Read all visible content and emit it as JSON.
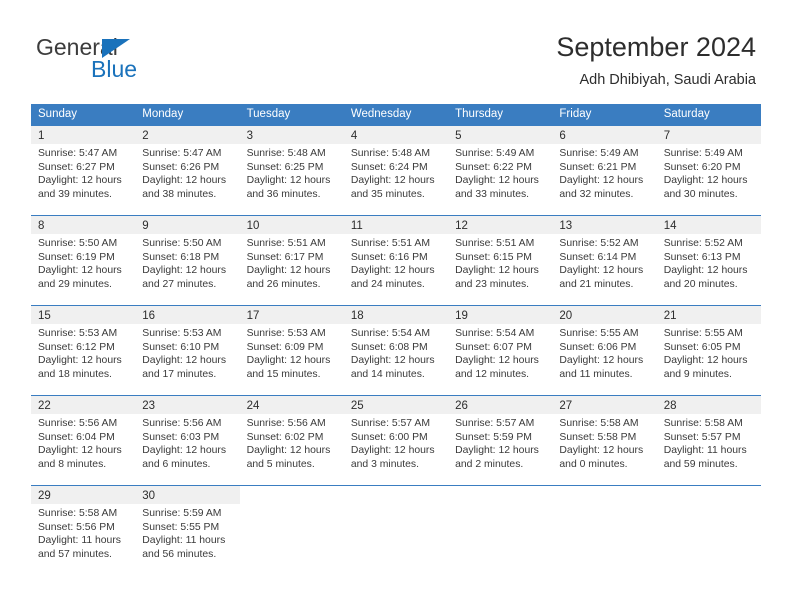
{
  "logo": {
    "word_one": "General",
    "word_two": "Blue",
    "triangle_icon": "triangle-icon",
    "accent_color": "#1a72bb"
  },
  "header": {
    "title": "September 2024",
    "subtitle": "Adh Dhibiyah, Saudi Arabia"
  },
  "calendar": {
    "header_color": "#3a7dc1",
    "weekdays": [
      "Sunday",
      "Monday",
      "Tuesday",
      "Wednesday",
      "Thursday",
      "Friday",
      "Saturday"
    ],
    "weeks": [
      [
        {
          "day": "1",
          "sunrise": "Sunrise: 5:47 AM",
          "sunset": "Sunset: 6:27 PM",
          "daylight_1": "Daylight: 12 hours",
          "daylight_2": "and 39 minutes."
        },
        {
          "day": "2",
          "sunrise": "Sunrise: 5:47 AM",
          "sunset": "Sunset: 6:26 PM",
          "daylight_1": "Daylight: 12 hours",
          "daylight_2": "and 38 minutes."
        },
        {
          "day": "3",
          "sunrise": "Sunrise: 5:48 AM",
          "sunset": "Sunset: 6:25 PM",
          "daylight_1": "Daylight: 12 hours",
          "daylight_2": "and 36 minutes."
        },
        {
          "day": "4",
          "sunrise": "Sunrise: 5:48 AM",
          "sunset": "Sunset: 6:24 PM",
          "daylight_1": "Daylight: 12 hours",
          "daylight_2": "and 35 minutes."
        },
        {
          "day": "5",
          "sunrise": "Sunrise: 5:49 AM",
          "sunset": "Sunset: 6:22 PM",
          "daylight_1": "Daylight: 12 hours",
          "daylight_2": "and 33 minutes."
        },
        {
          "day": "6",
          "sunrise": "Sunrise: 5:49 AM",
          "sunset": "Sunset: 6:21 PM",
          "daylight_1": "Daylight: 12 hours",
          "daylight_2": "and 32 minutes."
        },
        {
          "day": "7",
          "sunrise": "Sunrise: 5:49 AM",
          "sunset": "Sunset: 6:20 PM",
          "daylight_1": "Daylight: 12 hours",
          "daylight_2": "and 30 minutes."
        }
      ],
      [
        {
          "day": "8",
          "sunrise": "Sunrise: 5:50 AM",
          "sunset": "Sunset: 6:19 PM",
          "daylight_1": "Daylight: 12 hours",
          "daylight_2": "and 29 minutes."
        },
        {
          "day": "9",
          "sunrise": "Sunrise: 5:50 AM",
          "sunset": "Sunset: 6:18 PM",
          "daylight_1": "Daylight: 12 hours",
          "daylight_2": "and 27 minutes."
        },
        {
          "day": "10",
          "sunrise": "Sunrise: 5:51 AM",
          "sunset": "Sunset: 6:17 PM",
          "daylight_1": "Daylight: 12 hours",
          "daylight_2": "and 26 minutes."
        },
        {
          "day": "11",
          "sunrise": "Sunrise: 5:51 AM",
          "sunset": "Sunset: 6:16 PM",
          "daylight_1": "Daylight: 12 hours",
          "daylight_2": "and 24 minutes."
        },
        {
          "day": "12",
          "sunrise": "Sunrise: 5:51 AM",
          "sunset": "Sunset: 6:15 PM",
          "daylight_1": "Daylight: 12 hours",
          "daylight_2": "and 23 minutes."
        },
        {
          "day": "13",
          "sunrise": "Sunrise: 5:52 AM",
          "sunset": "Sunset: 6:14 PM",
          "daylight_1": "Daylight: 12 hours",
          "daylight_2": "and 21 minutes."
        },
        {
          "day": "14",
          "sunrise": "Sunrise: 5:52 AM",
          "sunset": "Sunset: 6:13 PM",
          "daylight_1": "Daylight: 12 hours",
          "daylight_2": "and 20 minutes."
        }
      ],
      [
        {
          "day": "15",
          "sunrise": "Sunrise: 5:53 AM",
          "sunset": "Sunset: 6:12 PM",
          "daylight_1": "Daylight: 12 hours",
          "daylight_2": "and 18 minutes."
        },
        {
          "day": "16",
          "sunrise": "Sunrise: 5:53 AM",
          "sunset": "Sunset: 6:10 PM",
          "daylight_1": "Daylight: 12 hours",
          "daylight_2": "and 17 minutes."
        },
        {
          "day": "17",
          "sunrise": "Sunrise: 5:53 AM",
          "sunset": "Sunset: 6:09 PM",
          "daylight_1": "Daylight: 12 hours",
          "daylight_2": "and 15 minutes."
        },
        {
          "day": "18",
          "sunrise": "Sunrise: 5:54 AM",
          "sunset": "Sunset: 6:08 PM",
          "daylight_1": "Daylight: 12 hours",
          "daylight_2": "and 14 minutes."
        },
        {
          "day": "19",
          "sunrise": "Sunrise: 5:54 AM",
          "sunset": "Sunset: 6:07 PM",
          "daylight_1": "Daylight: 12 hours",
          "daylight_2": "and 12 minutes."
        },
        {
          "day": "20",
          "sunrise": "Sunrise: 5:55 AM",
          "sunset": "Sunset: 6:06 PM",
          "daylight_1": "Daylight: 12 hours",
          "daylight_2": "and 11 minutes."
        },
        {
          "day": "21",
          "sunrise": "Sunrise: 5:55 AM",
          "sunset": "Sunset: 6:05 PM",
          "daylight_1": "Daylight: 12 hours",
          "daylight_2": "and 9 minutes."
        }
      ],
      [
        {
          "day": "22",
          "sunrise": "Sunrise: 5:56 AM",
          "sunset": "Sunset: 6:04 PM",
          "daylight_1": "Daylight: 12 hours",
          "daylight_2": "and 8 minutes."
        },
        {
          "day": "23",
          "sunrise": "Sunrise: 5:56 AM",
          "sunset": "Sunset: 6:03 PM",
          "daylight_1": "Daylight: 12 hours",
          "daylight_2": "and 6 minutes."
        },
        {
          "day": "24",
          "sunrise": "Sunrise: 5:56 AM",
          "sunset": "Sunset: 6:02 PM",
          "daylight_1": "Daylight: 12 hours",
          "daylight_2": "and 5 minutes."
        },
        {
          "day": "25",
          "sunrise": "Sunrise: 5:57 AM",
          "sunset": "Sunset: 6:00 PM",
          "daylight_1": "Daylight: 12 hours",
          "daylight_2": "and 3 minutes."
        },
        {
          "day": "26",
          "sunrise": "Sunrise: 5:57 AM",
          "sunset": "Sunset: 5:59 PM",
          "daylight_1": "Daylight: 12 hours",
          "daylight_2": "and 2 minutes."
        },
        {
          "day": "27",
          "sunrise": "Sunrise: 5:58 AM",
          "sunset": "Sunset: 5:58 PM",
          "daylight_1": "Daylight: 12 hours",
          "daylight_2": "and 0 minutes."
        },
        {
          "day": "28",
          "sunrise": "Sunrise: 5:58 AM",
          "sunset": "Sunset: 5:57 PM",
          "daylight_1": "Daylight: 11 hours",
          "daylight_2": "and 59 minutes."
        }
      ],
      [
        {
          "day": "29",
          "sunrise": "Sunrise: 5:58 AM",
          "sunset": "Sunset: 5:56 PM",
          "daylight_1": "Daylight: 11 hours",
          "daylight_2": "and 57 minutes."
        },
        {
          "day": "30",
          "sunrise": "Sunrise: 5:59 AM",
          "sunset": "Sunset: 5:55 PM",
          "daylight_1": "Daylight: 11 hours",
          "daylight_2": "and 56 minutes."
        },
        {
          "day": "",
          "sunrise": "",
          "sunset": "",
          "daylight_1": "",
          "daylight_2": ""
        },
        {
          "day": "",
          "sunrise": "",
          "sunset": "",
          "daylight_1": "",
          "daylight_2": ""
        },
        {
          "day": "",
          "sunrise": "",
          "sunset": "",
          "daylight_1": "",
          "daylight_2": ""
        },
        {
          "day": "",
          "sunrise": "",
          "sunset": "",
          "daylight_1": "",
          "daylight_2": ""
        },
        {
          "day": "",
          "sunrise": "",
          "sunset": "",
          "daylight_1": "",
          "daylight_2": ""
        }
      ]
    ]
  }
}
